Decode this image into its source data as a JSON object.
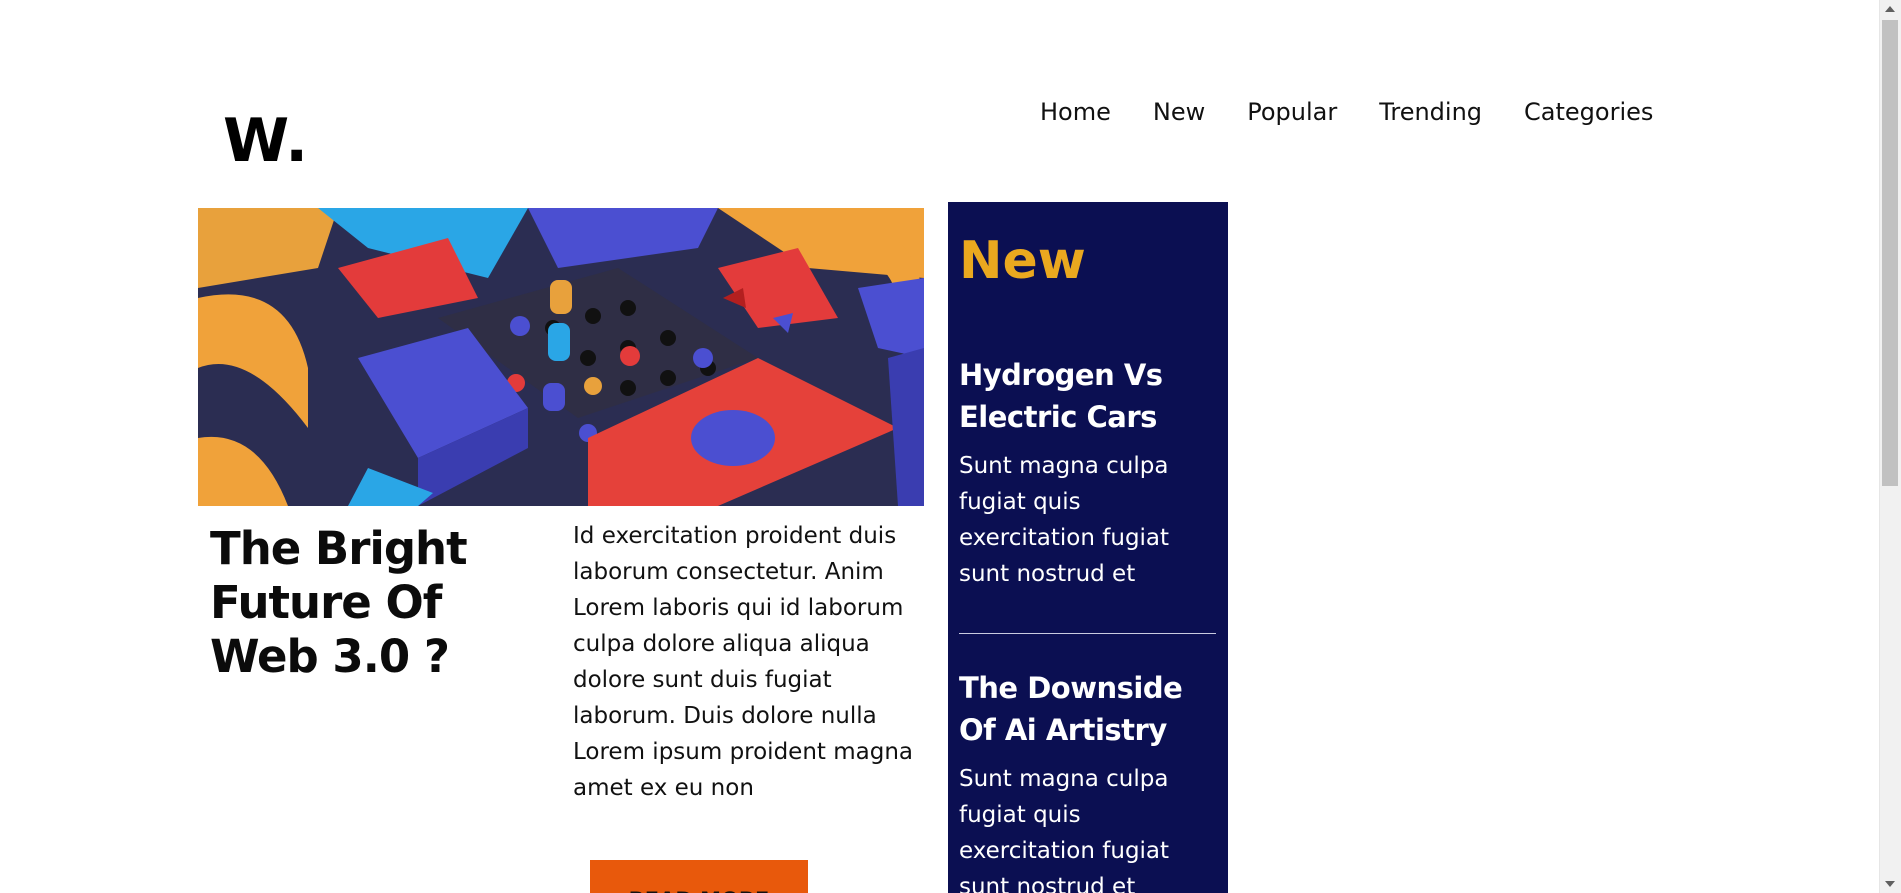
{
  "header": {
    "logo": "W.",
    "nav": [
      "Home",
      "New",
      "Popular",
      "Trending",
      "Categories"
    ]
  },
  "featured": {
    "image_icon": "abstract-3d-blocks-image",
    "title": "The Bright Future Of Web 3.0 ?",
    "excerpt": "Id exercitation proident duis laborum consectetur. Anim Lorem laboris qui id laborum culpa dolore aliqua aliqua dolore sunt duis fugiat laborum. Duis dolore nulla Lorem ipsum proident magna amet ex eu non",
    "read_more_label": "READ MORE"
  },
  "sidebar": {
    "title": "New",
    "articles": [
      {
        "title": "Hydrogen Vs Electric Cars",
        "text": "Sunt magna culpa fugiat quis exercitation fugiat sunt nostrud et"
      },
      {
        "title": "The Downside Of Ai Artistry",
        "text": "Sunt magna culpa fugiat quis exercitation fugiat sunt nostrud et"
      }
    ]
  },
  "colors": {
    "sidebar_bg": "#0b0f52",
    "sidebar_title": "#eaa81f",
    "button_bg": "#e8590c"
  }
}
